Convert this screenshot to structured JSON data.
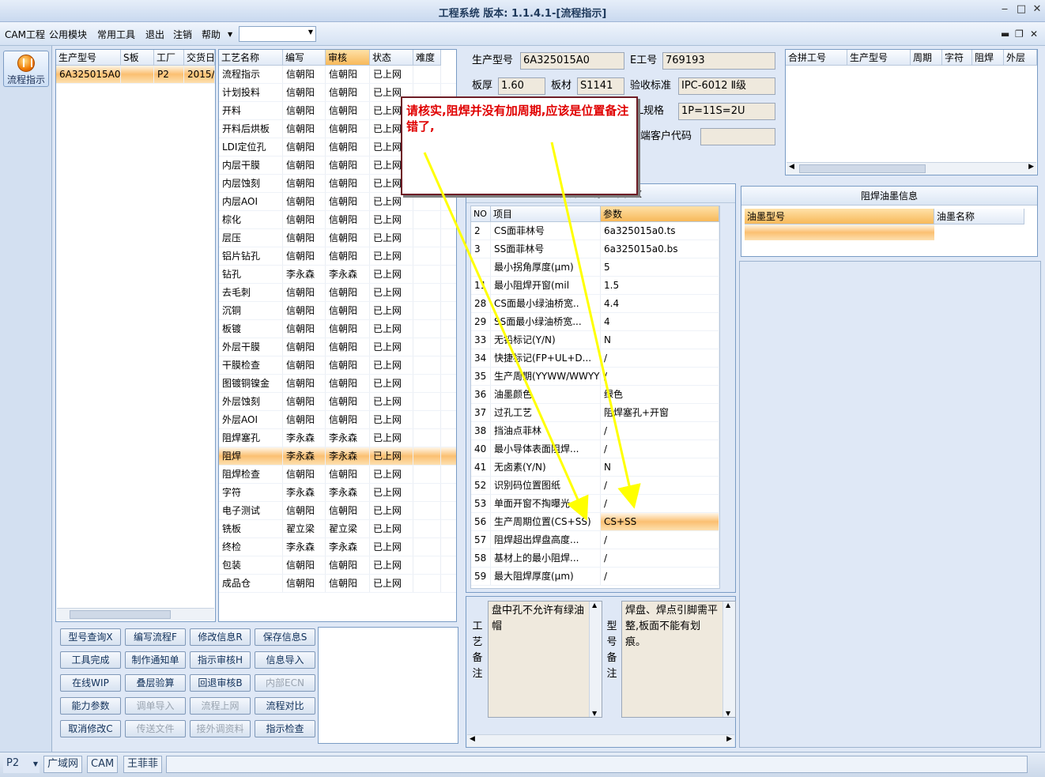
{
  "window": {
    "title": "工程系统 版本: 1.1.4.1-[流程指示]",
    "min_icon": "minimize-icon",
    "max_icon": "maximize-icon",
    "close_icon": "close-icon"
  },
  "menu": {
    "items": [
      "CAM工程",
      "公用模块",
      "常用工具",
      "退出",
      "注销",
      "帮助"
    ],
    "combo_value": ""
  },
  "nav": {
    "label": "流程指示",
    "icon": "flow-icon"
  },
  "order_list": {
    "headers": [
      "生产型号",
      "S板",
      "工厂",
      "交货日"
    ],
    "rows": [
      [
        "6A325015A0",
        "",
        "P2",
        "2015/"
      ]
    ]
  },
  "process": {
    "headers": [
      "工艺名称",
      "编写",
      "审核",
      "状态",
      "难度"
    ],
    "rows": [
      [
        "流程指示",
        "信朝阳",
        "信朝阳",
        "已上网",
        ""
      ],
      [
        "计划投料",
        "信朝阳",
        "信朝阳",
        "已上网",
        ""
      ],
      [
        "开料",
        "信朝阳",
        "信朝阳",
        "已上网",
        ""
      ],
      [
        "开料后烘板",
        "信朝阳",
        "信朝阳",
        "已上网",
        ""
      ],
      [
        "LDI定位孔",
        "信朝阳",
        "信朝阳",
        "已上网",
        ""
      ],
      [
        "内层干膜",
        "信朝阳",
        "信朝阳",
        "已上网",
        ""
      ],
      [
        "内层蚀刻",
        "信朝阳",
        "信朝阳",
        "已上网",
        ""
      ],
      [
        "内层AOI",
        "信朝阳",
        "信朝阳",
        "已上网",
        ""
      ],
      [
        "棕化",
        "信朝阳",
        "信朝阳",
        "已上网",
        ""
      ],
      [
        "层压",
        "信朝阳",
        "信朝阳",
        "已上网",
        ""
      ],
      [
        "铝片钻孔",
        "信朝阳",
        "信朝阳",
        "已上网",
        ""
      ],
      [
        "钻孔",
        "李永森",
        "李永森",
        "已上网",
        ""
      ],
      [
        "去毛刺",
        "信朝阳",
        "信朝阳",
        "已上网",
        ""
      ],
      [
        "沉铜",
        "信朝阳",
        "信朝阳",
        "已上网",
        ""
      ],
      [
        "板镀",
        "信朝阳",
        "信朝阳",
        "已上网",
        ""
      ],
      [
        "外层干膜",
        "信朝阳",
        "信朝阳",
        "已上网",
        ""
      ],
      [
        "干膜检查",
        "信朝阳",
        "信朝阳",
        "已上网",
        ""
      ],
      [
        "图镀铜镍金",
        "信朝阳",
        "信朝阳",
        "已上网",
        ""
      ],
      [
        "外层蚀刻",
        "信朝阳",
        "信朝阳",
        "已上网",
        ""
      ],
      [
        "外层AOI",
        "信朝阳",
        "信朝阳",
        "已上网",
        ""
      ],
      [
        "阻焊塞孔",
        "李永森",
        "李永森",
        "已上网",
        ""
      ],
      [
        "阻焊",
        "李永森",
        "李永森",
        "已上网",
        ""
      ],
      [
        "阻焊检查",
        "信朝阳",
        "信朝阳",
        "已上网",
        ""
      ],
      [
        "字符",
        "李永森",
        "李永森",
        "已上网",
        ""
      ],
      [
        "电子测试",
        "信朝阳",
        "信朝阳",
        "已上网",
        ""
      ],
      [
        "铣板",
        "翟立梁",
        "翟立梁",
        "已上网",
        ""
      ],
      [
        "终检",
        "李永森",
        "李永森",
        "已上网",
        ""
      ],
      [
        "包装",
        "信朝阳",
        "信朝阳",
        "已上网",
        ""
      ],
      [
        "成品仓",
        "信朝阳",
        "信朝阳",
        "已上网",
        ""
      ]
    ],
    "selected_index": 21
  },
  "buttons": [
    [
      "型号查询X",
      "编写流程F",
      "修改信息R",
      "保存信息S"
    ],
    [
      "工具完成",
      "制作通知单",
      "指示审核H",
      "信息导入"
    ],
    [
      "在线WIP",
      "叠层验算",
      "回退审核B",
      "内部ECN"
    ],
    [
      "能力参数",
      "调单导入",
      "流程上网",
      "流程对比"
    ],
    [
      "取消修改C",
      "传送文件",
      "接外调资料",
      "指示检查"
    ]
  ],
  "disabled_buttons": [
    "内部ECN",
    "调单导入",
    "流程上网",
    "传送文件",
    "接外调资料"
  ],
  "info": {
    "prod_label": "生产型号",
    "prod_value": "6A325015A0",
    "e_label": "E工号",
    "e_value": "769193",
    "thick_label": "板厚",
    "thick_value": "1.60",
    "mat_label": "板材",
    "mat_value": "S1141",
    "std_label": "验收标准",
    "std_value": "IPC-6012 Ⅱ级",
    "nl_label": "NL规格",
    "nl_value": "1P=11S=2U",
    "cust_label": "终端客户代码",
    "cust_value": ""
  },
  "merge_table": {
    "headers": [
      "合拼工号",
      "生产型号",
      "周期",
      "字符",
      "阻焊",
      "外层"
    ]
  },
  "params": {
    "title": "阻焊: 工序基本参数",
    "headers": [
      "NO",
      "项目",
      "参数"
    ],
    "rows": [
      [
        "2",
        "CS面菲林号",
        "6a325015a0.ts"
      ],
      [
        "3",
        "SS面菲林号",
        "6a325015a0.bs"
      ],
      [
        "",
        "最小拐角厚度(μm)",
        "5"
      ],
      [
        "11",
        "最小阻焊开窗(mil",
        "1.5"
      ],
      [
        "28",
        "CS面最小绿油桥宽..",
        "4.4"
      ],
      [
        "29",
        "SS面最小绿油桥宽...",
        "4"
      ],
      [
        "33",
        "无铅标记(Y/N)",
        "N"
      ],
      [
        "34",
        "快捷标记(FP+UL+D...",
        "/"
      ],
      [
        "35",
        "生产周期(YYWW/WWYY)",
        "/"
      ],
      [
        "36",
        "油墨颜色",
        "绿色"
      ],
      [
        "37",
        "过孔工艺",
        "阻焊塞孔+开窗"
      ],
      [
        "38",
        "挡油点菲林",
        "/"
      ],
      [
        "40",
        "最小导体表面阻焊...",
        "/"
      ],
      [
        "41",
        "无卤素(Y/N)",
        "N"
      ],
      [
        "52",
        "识别码位置图纸",
        "/"
      ],
      [
        "53",
        "单面开窗不掏曝光...",
        "/"
      ],
      [
        "56",
        "生产周期位置(CS+SS)",
        "CS+SS"
      ],
      [
        "57",
        "阻焊超出焊盘高度...",
        "/"
      ],
      [
        "58",
        "基材上的最小阻焊...",
        "/"
      ],
      [
        "59",
        "最大阻焊厚度(μm)",
        "/"
      ]
    ],
    "selected_index": 16
  },
  "ink": {
    "title": "阻焊油墨信息",
    "headers": [
      "油墨型号",
      "油墨名称"
    ]
  },
  "notes": {
    "process_label": [
      "工",
      "艺",
      "备",
      "注"
    ],
    "process_text": "盘中孔不允许有绿油帽",
    "model_label": [
      "型",
      "号",
      "备",
      "注"
    ],
    "model_text": "焊盘、焊点引脚需平整,板面不能有划痕。"
  },
  "callout": {
    "text": "请核实,阻焊并没有加周期,应该是位置备注错了,"
  },
  "status": {
    "factory": "P2",
    "network": "广域网",
    "module": "CAM",
    "user": "王菲菲"
  }
}
